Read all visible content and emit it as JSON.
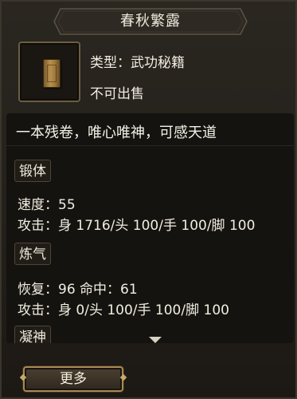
{
  "item": {
    "name": "春秋繁露",
    "type_line": "类型：武功秘籍",
    "sell_status": "不可出售",
    "icon": "book-scroll-icon"
  },
  "description": "一本残卷，唯心唯神，可感天道",
  "sections": [
    {
      "label": "锻体",
      "lines": [
        "速度：55",
        "攻击：身 1716/头 100/手 100/脚 100"
      ]
    },
    {
      "label": "炼气",
      "lines": [
        "恢复：96 命中：61",
        "攻击：身 0/头 100/手 100/脚 100"
      ]
    },
    {
      "label": "凝神",
      "lines": []
    }
  ],
  "more_button_label": "更多",
  "colors": {
    "panel_bg": "#231f1a",
    "text": "#f2ede2",
    "gold_accent": "#a88a55"
  }
}
